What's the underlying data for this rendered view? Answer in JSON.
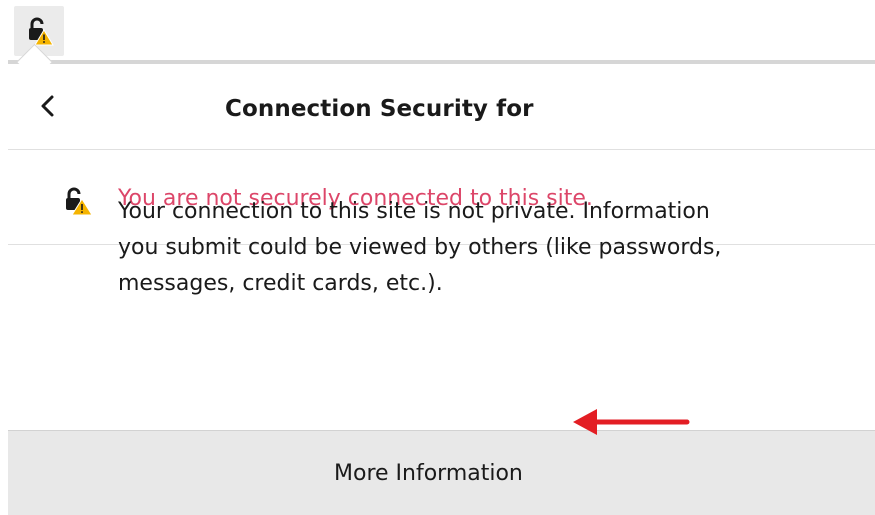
{
  "header": {
    "title": "Connection Security for",
    "back_icon": "chevron-left-icon"
  },
  "urlbar": {
    "lock_icon": "insecure-lock-warning-icon"
  },
  "status": {
    "text": "You are not securely connected to this site.",
    "color": "#d7264f",
    "icon": "insecure-lock-warning-icon"
  },
  "description": {
    "line1": "Your connection to this site is not private. Information",
    "line2": "you submit could be viewed by others (like passwords,",
    "line3": "messages, credit cards, etc.)."
  },
  "footer": {
    "more_info_label": "More Information"
  },
  "annotation": {
    "arrow_color": "#e31e24"
  }
}
